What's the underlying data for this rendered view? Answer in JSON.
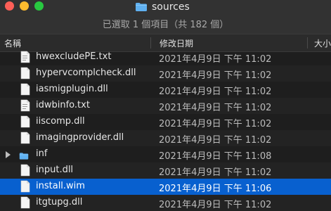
{
  "window": {
    "title": "sources",
    "subtitle": "已選取 1 個項目（共 182 個）"
  },
  "columns": {
    "name": "名稱",
    "modified": "修改日期",
    "size": "大小"
  },
  "files": [
    {
      "name": "hwexcludePE.txt",
      "date": "2021年4月9日 下午 11:02",
      "kind": "txt"
    },
    {
      "name": "hypervcomplcheck.dll",
      "date": "2021年4月9日 下午 11:02",
      "kind": "dll"
    },
    {
      "name": "iasmigplugin.dll",
      "date": "2021年4月9日 下午 11:02",
      "kind": "dll"
    },
    {
      "name": "idwbinfo.txt",
      "date": "2021年4月9日 下午 11:02",
      "kind": "txt"
    },
    {
      "name": "iiscomp.dll",
      "date": "2021年4月9日 下午 11:02",
      "kind": "dll"
    },
    {
      "name": "imagingprovider.dll",
      "date": "2021年4月9日 下午 11:02",
      "kind": "dll"
    },
    {
      "name": "inf",
      "date": "2021年4月9日 下午 11:08",
      "kind": "folder"
    },
    {
      "name": "input.dll",
      "date": "2021年4月9日 下午 11:02",
      "kind": "dll"
    },
    {
      "name": "install.wim",
      "date": "2021年4月9日 下午 11:06",
      "kind": "wim",
      "selected": true
    },
    {
      "name": "itgtupg.dll",
      "date": "2021年4月9日 下午 11:02",
      "kind": "dll"
    }
  ],
  "colors": {
    "selection": "#0860cf",
    "folder": "#5fb0f0"
  }
}
